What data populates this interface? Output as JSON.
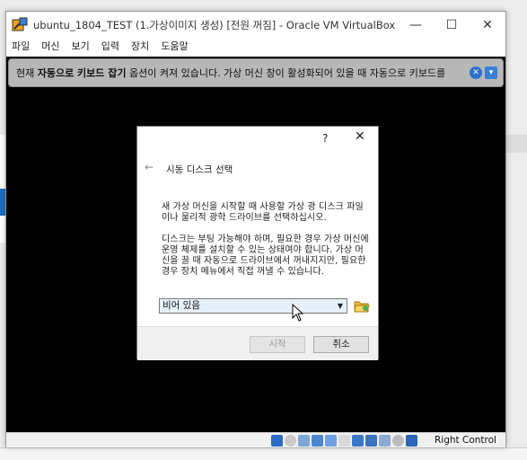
{
  "window": {
    "title": "ubuntu_1804_TEST (1.가상이미지 생성) [전원 꺼짐] - Oracle VM VirtualBox",
    "minimize": "—",
    "maximize": "☐",
    "close": "✕"
  },
  "menu": [
    "파일",
    "머신",
    "보기",
    "입력",
    "장치",
    "도움말"
  ],
  "notice": {
    "prefix": "현재 ",
    "bold1": "자동으로 키보드 잡기",
    "suffix": " 옵션이 켜져 있습니다. 가상 머신 창이 활성화되어 있을 때 자동으로 키보드를",
    "close_icon": "close-icon",
    "info_icon": "info-icon"
  },
  "dialog": {
    "help": "?",
    "close": "✕",
    "back": "←",
    "title": "시동 디스크 선택",
    "para1": "새 가상 머신을 시작할 때 사용할 가상 광 디스크 파일이나 물리적 광학 드라이브를 선택하십시오.",
    "para2": "디스크는 부팅 가능해야 하며, 필요한 경우 가상 머신에 운영 체제를 설치할 수 있는 상태여야 합니다. 가상 머신을 끌 때 자동으로 드라이브에서 꺼내지지만, 필요한 경우 장치 메뉴에서 직접 꺼낼 수 있습니다.",
    "select_value": "비어 있음",
    "start_button": "시작",
    "cancel_button": "취소"
  },
  "status": {
    "host_key": "Right Control"
  },
  "colors": {
    "notice_bg": "#b7b7b7",
    "screen_bg": "#000000",
    "select_bg": "#e6f0fb",
    "accent": "#2d6fd0"
  }
}
